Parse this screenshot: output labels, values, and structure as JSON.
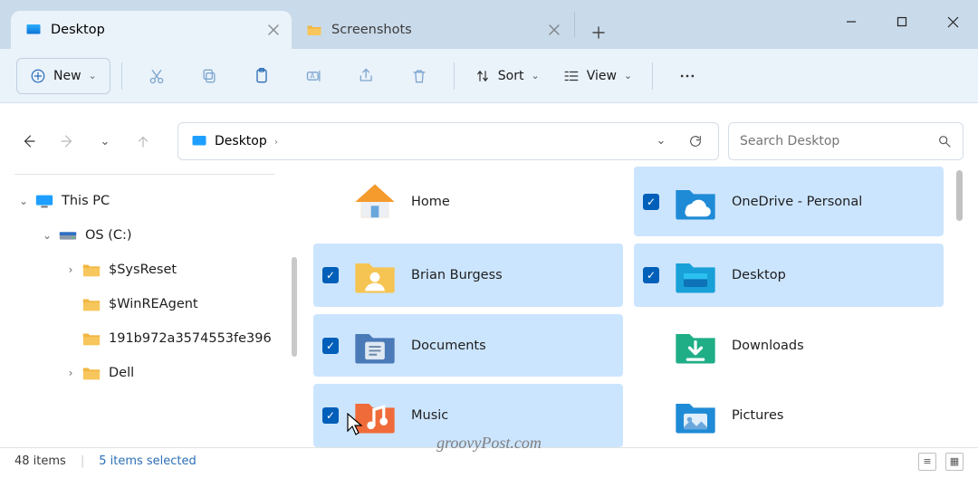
{
  "tabs": [
    {
      "label": "Desktop",
      "active": true
    },
    {
      "label": "Screenshots",
      "active": false
    }
  ],
  "toolbar": {
    "new_label": "New",
    "sort_label": "Sort",
    "view_label": "View"
  },
  "address": {
    "location": "Desktop"
  },
  "search": {
    "placeholder": "Search Desktop"
  },
  "tree": [
    {
      "level": 0,
      "exp": "open",
      "label": "This PC",
      "icon": "pc"
    },
    {
      "level": 1,
      "exp": "open",
      "label": "OS (C:)",
      "icon": "drive"
    },
    {
      "level": 2,
      "exp": "closed",
      "label": "$SysReset",
      "icon": "folder"
    },
    {
      "level": 2,
      "exp": "none",
      "label": "$WinREAgent",
      "icon": "folder"
    },
    {
      "level": 2,
      "exp": "none",
      "label": "191b972a3574553fe396",
      "icon": "folder"
    },
    {
      "level": 2,
      "exp": "closed",
      "label": "Dell",
      "icon": "folder"
    }
  ],
  "itemsLeft": [
    {
      "name": "Home",
      "icon": "home",
      "selected": false
    },
    {
      "name": "Brian Burgess",
      "icon": "user-folder",
      "selected": true
    },
    {
      "name": "Documents",
      "icon": "documents",
      "selected": true
    },
    {
      "name": "Music",
      "icon": "music",
      "selected": true
    }
  ],
  "itemsRight": [
    {
      "name": "OneDrive - Personal",
      "icon": "onedrive",
      "selected": true
    },
    {
      "name": "Desktop",
      "icon": "desktop",
      "selected": true
    },
    {
      "name": "Downloads",
      "icon": "downloads",
      "selected": false
    },
    {
      "name": "Pictures",
      "icon": "pictures",
      "selected": false
    }
  ],
  "status": {
    "count": "48 items",
    "selected": "5 items selected"
  },
  "watermark": "groovyPost.com"
}
